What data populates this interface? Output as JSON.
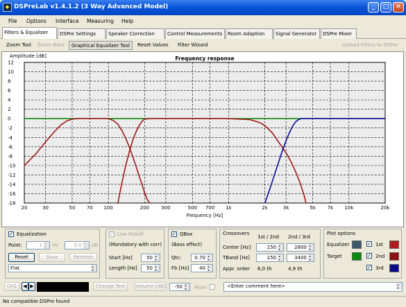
{
  "window": {
    "title": "DSPreLab  v1.4.1.2 (3 Way Advanced Model)",
    "min": "_",
    "max": "□",
    "close": "✕"
  },
  "menu": [
    "File",
    "Options",
    "Interface",
    "Measuring",
    "Help"
  ],
  "tabs": [
    "Filters & Equalizer",
    "DSPre Settings",
    "Speaker Correction",
    "Control Measurements",
    "Room Adaption",
    "Signal Generator",
    "DSPre Mixer"
  ],
  "toolbar": {
    "zoom": "Zoom Tool",
    "zoom_back": "Zoom Back",
    "geq": "Graphical Equalizer Tool",
    "reset": "Reset Values",
    "wizard": "Filter Wizard",
    "upload": "Upload Filters to DSPre"
  },
  "chart_data": {
    "type": "line",
    "title": "Frequency response",
    "xlabel": "Frequency [Hz]",
    "ylabel": "Amplitude [dB]",
    "xscale": "log",
    "xlim": [
      20,
      20000
    ],
    "ylim": [
      -18,
      12
    ],
    "xticks": [
      "20",
      "30",
      "50",
      "70",
      "100",
      "200",
      "300",
      "500",
      "700",
      "1k",
      "2k",
      "3k",
      "5k",
      "7k",
      "10k",
      "20k"
    ],
    "yticks": [
      "12",
      "10",
      "8",
      "6",
      "4",
      "2",
      "0",
      "-2",
      "-4",
      "-6",
      "-8",
      "-10",
      "-12",
      "-14",
      "-16",
      "-18"
    ],
    "grid": true,
    "series": [
      {
        "color": "#a01818",
        "x": [
          20,
          25,
          30,
          35,
          40,
          45,
          50,
          55,
          60,
          80,
          100,
          110,
          120,
          130,
          140,
          150,
          160,
          170,
          180,
          190,
          200,
          210,
          220
        ],
        "y": [
          -10,
          -7.5,
          -5,
          -3,
          -1.4,
          -0.5,
          -0.1,
          0,
          0,
          0,
          0,
          -0.4,
          -1.2,
          -2.6,
          -4.3,
          -6.2,
          -8.2,
          -10.2,
          -12.2,
          -14,
          -15.8,
          -17.2,
          -18
        ]
      },
      {
        "color": "#a01818",
        "x": [
          120,
          130,
          140,
          150,
          160,
          170,
          180,
          190,
          200,
          220,
          250,
          400,
          1000,
          1500,
          1800,
          2000,
          2300,
          2600,
          3000,
          3300,
          3600,
          3900,
          4200,
          4400
        ],
        "y": [
          -18,
          -13.5,
          -9.8,
          -6.9,
          -4.5,
          -2.8,
          -1.5,
          -0.6,
          -0.1,
          0,
          0,
          0,
          0,
          -0.2,
          -0.8,
          -1.5,
          -3,
          -5,
          -7.3,
          -9.2,
          -11.3,
          -13.5,
          -16,
          -18
        ]
      },
      {
        "color": "#0a0aa0",
        "x": [
          2000,
          2200,
          2400,
          2600,
          2800,
          3000,
          3200,
          3400,
          3600,
          3800,
          4000,
          5000,
          10000,
          20000
        ],
        "y": [
          -18,
          -15,
          -12,
          -9.3,
          -6.8,
          -4.7,
          -3,
          -1.6,
          -0.7,
          -0.2,
          0,
          0,
          0,
          0
        ]
      },
      {
        "color": "#0a8a0a",
        "x": [
          20,
          20000
        ],
        "y": [
          0,
          0
        ]
      }
    ]
  },
  "eq": {
    "label": "Equalization",
    "point_label": "Point:",
    "point_val": "1",
    "hz": "Hz",
    "gain_val": "0.0",
    "db": "dB",
    "reset": "Reset",
    "save": "Save",
    "remove": "Remove",
    "preset": "Flat"
  },
  "lowroll": {
    "label": "Low Rolloff",
    "note": "(Mandatory with corr)",
    "start_label": "Start [Hz]",
    "start_val": "50",
    "length_label": "Length [Hz]",
    "length_val": "50"
  },
  "qbox": {
    "label": "QBox",
    "note": "(Bass effect)",
    "qtc_label": "Qtc:",
    "qtc_val": "0.70",
    "fb_label": "Fb [Hz]",
    "fb_val": "40"
  },
  "crossovers": {
    "label": "Crossovers",
    "col1": "1st / 2nd",
    "col2": "2nd / 3rd",
    "center_label": "Center [Hz]",
    "center1": "150",
    "center2": "2800",
    "tband_label": "TBand [Hz]",
    "tband1": "150",
    "tband2": "3400",
    "approx_label": "Appr. order",
    "order1": "6,0 th",
    "order2": "4,9 th"
  },
  "plot_options": {
    "label": "Plot options",
    "equalizer": "Equalizer",
    "target": "Target",
    "eq_color": "#3a5a6a",
    "target_color": "#0a8a0a",
    "first": "1st",
    "second": "2nd",
    "third": "3rd",
    "c1": "#b01c1c",
    "c2": "#8e1010",
    "c3": "#0a0a8a"
  },
  "bottom": {
    "ch": "CH1",
    "change_text": "Change Text",
    "volume": "Volume [dB]",
    "volume_val": "-50",
    "mute": "Mute",
    "comment": "<Enter comment here>"
  },
  "status": "No compatible DSPre found"
}
